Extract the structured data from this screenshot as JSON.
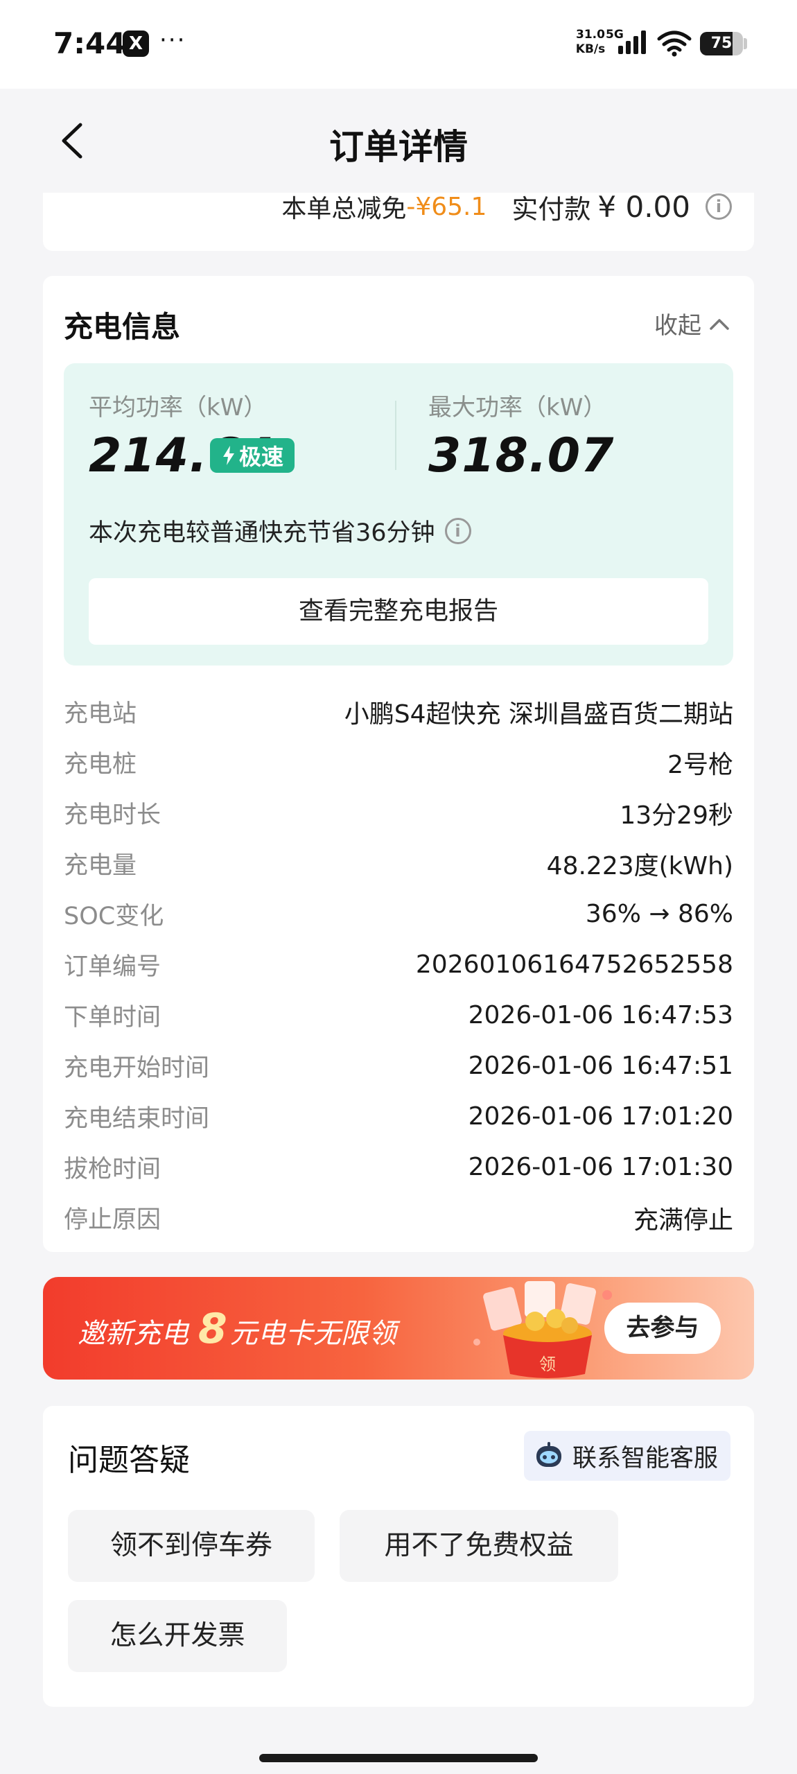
{
  "status_bar": {
    "time": "7:44",
    "app_icon": "X",
    "more": "···",
    "net_speed": "31.0",
    "net_unit": "KB/s",
    "network": "5G",
    "battery": "75",
    "battery_level": 0.75,
    "icons": [
      "signal-icon",
      "wifi-icon",
      "battery-icon"
    ]
  },
  "nav": {
    "title": "订单详情",
    "back_icon": "chevron-left-icon"
  },
  "summary": {
    "discount_label": "本单总减免",
    "discount_value": "-¥65.1",
    "paid_label": "实付款",
    "paid_value": "¥ 0.00",
    "info_icon": "i",
    "accent_color": "#f08d1a"
  },
  "charging": {
    "title": "充电信息",
    "collapse_label": "收起",
    "avg_power_label": "平均功率（kW）",
    "avg_power_value": "214.64",
    "badge_label": "极速",
    "max_power_label": "最大功率（kW）",
    "max_power_value": "318.07",
    "saving_text": "本次充电较普通快充节省36分钟",
    "info_icon": "i",
    "report_button": "查看完整充电报告",
    "panel_color": "#e6f7f3",
    "badge_color": "#22b38a",
    "details": [
      {
        "label": "充电站",
        "value": "小鹏S4超快充 深圳昌盛百货二期站"
      },
      {
        "label": "充电桩",
        "value": "2号枪"
      },
      {
        "label": "充电时长",
        "value": "13分29秒"
      },
      {
        "label": "充电量",
        "value": "48.223度(kWh)"
      },
      {
        "label": "SOC变化",
        "value": "36% → 86%"
      },
      {
        "label": "订单编号",
        "value": "20260106164752652558"
      },
      {
        "label": "下单时间",
        "value": "2026-01-06 16:47:53"
      },
      {
        "label": "充电开始时间",
        "value": "2026-01-06 16:47:51"
      },
      {
        "label": "充电结束时间",
        "value": "2026-01-06 17:01:20"
      },
      {
        "label": "拔枪时间",
        "value": "2026-01-06 17:01:30"
      },
      {
        "label": "停止原因",
        "value": "充满停止"
      }
    ]
  },
  "promo": {
    "text_prefix": "邀新充电",
    "amount": "8",
    "text_suffix": "元电卡无限领",
    "button": "去参与",
    "deco_char": "领"
  },
  "faq": {
    "title": "问题答疑",
    "support_button": "联系智能客服",
    "chips": [
      "领不到停车券",
      "用不了免费权益",
      "怎么开发票"
    ]
  }
}
